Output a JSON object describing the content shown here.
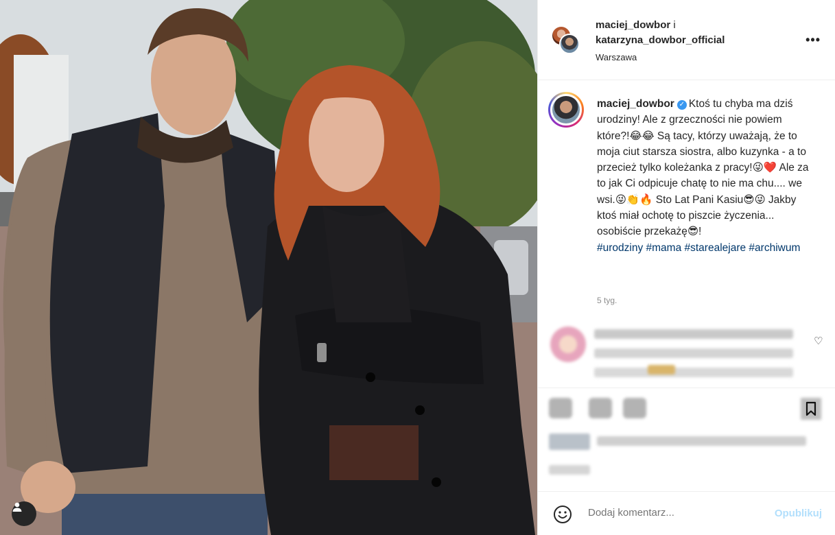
{
  "header": {
    "user1": "maciej_dowbor",
    "conjunction": " i",
    "user2": "katarzyna_dowbor_official",
    "location": "Warszawa",
    "more_icon": "more-horizontal-icon"
  },
  "caption": {
    "username": "maciej_dowbor",
    "text": "Ktoś tu chyba ma dziś urodziny! Ale z grzeczności nie powiem które?!😂😂 Są tacy, którzy uważają, że to moja ciut starsza siostra, albo kuzynka - a to przecież tylko koleżanka z pracy!😜❤️ Ale za to jak Ci odpicuje chatę to nie ma chu.... we wsi.😜👏🔥 Sto Lat Pani Kasiu😎😜 Jakby ktoś miał ochotę to piszcie życzenia... osobiście przekażę😎!",
    "hashtags": "#urodziny #mama #starealejare #archiwum",
    "time": "5 tyg."
  },
  "add_comment": {
    "placeholder": "Dodaj komentarz...",
    "publish": "Opublikuj"
  },
  "colors": {
    "link": "#00376b",
    "verified": "#3897f0",
    "publish_disabled": "#b2dffc"
  }
}
